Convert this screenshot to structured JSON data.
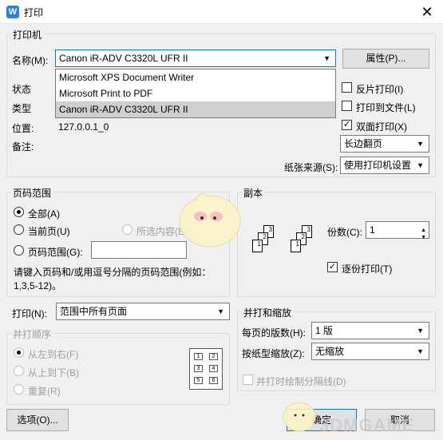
{
  "window": {
    "title": "打印",
    "app_icon": "W"
  },
  "printer_group": {
    "label": "打印机",
    "name_label": "名称(M):",
    "name_value": "Canon iR-ADV C3320L UFR II",
    "properties_button": "属性(P)...",
    "dropdown_options": [
      "Microsoft XPS Document Writer",
      "Microsoft Print to PDF",
      "Canon iR-ADV C3320L UFR II"
    ],
    "status_label": "状态",
    "type_label": "类型",
    "location_label": "位置:",
    "location_value": "127.0.0.1_0",
    "comment_label": "备注:",
    "reverse_print": "反片打印(I)",
    "print_to_file": "打印到文件(L)",
    "duplex_print": "双面打印(X)",
    "duplex_checked": true,
    "flip_value": "长边翻页",
    "paper_source_label": "纸张来源(S):",
    "paper_source_value": "使用打印机设置"
  },
  "page_range": {
    "label": "页码范围",
    "all": "全部(A)",
    "current": "当前页(U)",
    "selection": "所选内容(E)",
    "range": "页码范围(G):",
    "hint": "请键入页码和/或用逗号分隔的页码范围(例如：1,3,5-12)。"
  },
  "copies": {
    "label": "副本",
    "count_label": "份数(C):",
    "count_value": "1",
    "collate": "逐份打印(T)",
    "collate_checked": true,
    "pages": [
      "1",
      "2",
      "3"
    ]
  },
  "print_what": {
    "label": "打印(N):",
    "value": "范围中所有页面"
  },
  "order": {
    "label": "并打顺序",
    "ltr": "从左到右(F)",
    "ttb": "从上到下(B)",
    "repeat": "重复(R)",
    "preview": [
      "1",
      "2",
      "3",
      "4",
      "5",
      "6"
    ]
  },
  "zoom": {
    "label": "并打和缩放",
    "pages_per_sheet_label": "每页的版数(H):",
    "pages_per_sheet_value": "1 版",
    "scale_label": "按纸型缩放(Z):",
    "scale_value": "无缩放",
    "draw_lines": "并打时绘制分隔线(D)"
  },
  "buttons": {
    "options": "选项(O)...",
    "ok": "确定",
    "cancel": "取消"
  },
  "watermark": "3DMGAME"
}
